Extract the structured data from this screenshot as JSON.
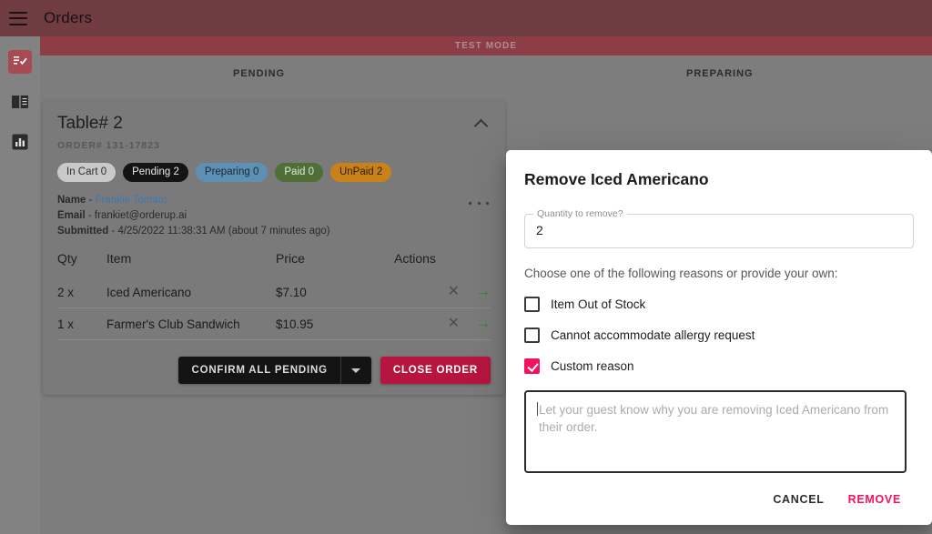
{
  "appbar": {
    "menu_icon": "hamburger-menu-icon",
    "title": "Orders"
  },
  "banner": {
    "text": "TEST MODE"
  },
  "sidebar": {
    "items": [
      {
        "icon": "orders-checklist-icon",
        "active": true
      },
      {
        "icon": "menu-book-icon",
        "active": false
      },
      {
        "icon": "bar-chart-icon",
        "active": false
      }
    ]
  },
  "columns": {
    "pending": "PENDING",
    "preparing": "PREPARING"
  },
  "order_card": {
    "table_title": "Table# 2",
    "collapse_icon": "chevron-up-icon",
    "order_number": "ORDER# 131-17823",
    "overflow_icon": "more-horizontal-icon",
    "chips": [
      {
        "label": "In Cart 0",
        "class": "incart"
      },
      {
        "label": "Pending 2",
        "class": "pending"
      },
      {
        "label": "Preparing 0",
        "class": "preparing"
      },
      {
        "label": "Paid 0",
        "class": "paid"
      },
      {
        "label": "UnPaid 2",
        "class": "unpaid"
      }
    ],
    "meta": {
      "name_label": "Name",
      "name_sep": " - ",
      "name_value": "Frankie Tomato",
      "email_label": "Email",
      "email_sep": " - ",
      "email_value": "frankiet@orderup.ai",
      "submitted_label": "Submitted",
      "submitted_sep": " - ",
      "submitted_value": "4/25/2022 11:38:31 AM (about 7 minutes ago)"
    },
    "table": {
      "headers": [
        "Qty",
        "Item",
        "Price",
        "Actions"
      ],
      "rows": [
        {
          "qty": "2 x",
          "item": "Iced Americano",
          "price": "$7.10",
          "remove_icon": "✕",
          "advance_icon": "→"
        },
        {
          "qty": "1 x",
          "item": "Farmer's Club Sandwich",
          "price": "$10.95",
          "remove_icon": "✕",
          "advance_icon": "→"
        }
      ]
    },
    "actions": {
      "confirm_label": "CONFIRM ALL PENDING",
      "confirm_caret_icon": "chevron-down-icon",
      "close_label": "CLOSE ORDER"
    }
  },
  "dialog": {
    "title": "Remove Iced Americano",
    "quantity_field": {
      "label": "Quantity to remove?",
      "value": "2"
    },
    "choose_label": "Choose one of the following reasons or provide your own:",
    "reasons": [
      {
        "label": "Item Out of Stock",
        "checked": false
      },
      {
        "label": "Cannot accommodate allergy request",
        "checked": false
      },
      {
        "label": "Custom reason",
        "checked": true
      }
    ],
    "custom_reason": {
      "value": "",
      "placeholder": "Let your guest know why you are removing Iced Americano from their order."
    },
    "cancel_label": "CANCEL",
    "remove_label": "REMOVE"
  },
  "colors": {
    "appbar": "#6e3c41",
    "test_mode_banner": "#8d3d46",
    "accent_pink": "#f4125c",
    "close_order_red": "#b5153f",
    "advance_green": "#1d8c20",
    "link_blue": "#3f78b5"
  }
}
